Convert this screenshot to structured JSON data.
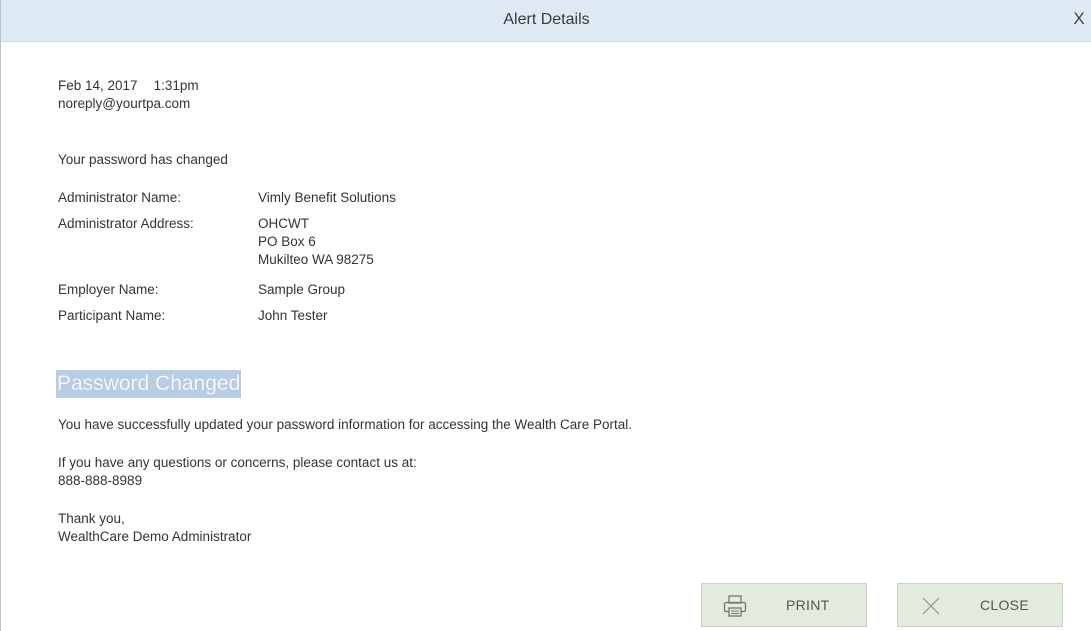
{
  "dialog": {
    "title": "Alert Details",
    "close_glyph": "X"
  },
  "message": {
    "date": "Feb 14, 2017",
    "time": "1:31pm",
    "sender": "noreply@yourtpa.com",
    "subject": "Your password has changed",
    "info": [
      {
        "label": "Administrator Name:",
        "value": [
          "Vimly Benefit Solutions"
        ]
      },
      {
        "label": "Administrator Address:",
        "value": [
          "OHCWT",
          "PO Box 6",
          "Mukilteo WA 98275"
        ]
      },
      {
        "label": "Employer Name:",
        "value": [
          "Sample Group"
        ]
      },
      {
        "label": "Participant Name:",
        "value": [
          "John Tester"
        ]
      }
    ],
    "heading": "Password Changed",
    "body_line1": "You have successfully updated your password information for accessing the Wealth Care Portal.",
    "body_line2": "If you have any questions or concerns, please contact us at:",
    "phone": "888-888-8989",
    "closing": "Thank you,",
    "signature": "WealthCare Demo Administrator"
  },
  "buttons": {
    "print_label": "PRINT",
    "close_label": "CLOSE",
    "print_icon": "printer-icon",
    "close_icon": "x-icon"
  },
  "colors": {
    "titlebar_bg": "#dfe9f3",
    "heading_highlight": "#b9cce4",
    "button_bg": "#e3ebdf"
  }
}
